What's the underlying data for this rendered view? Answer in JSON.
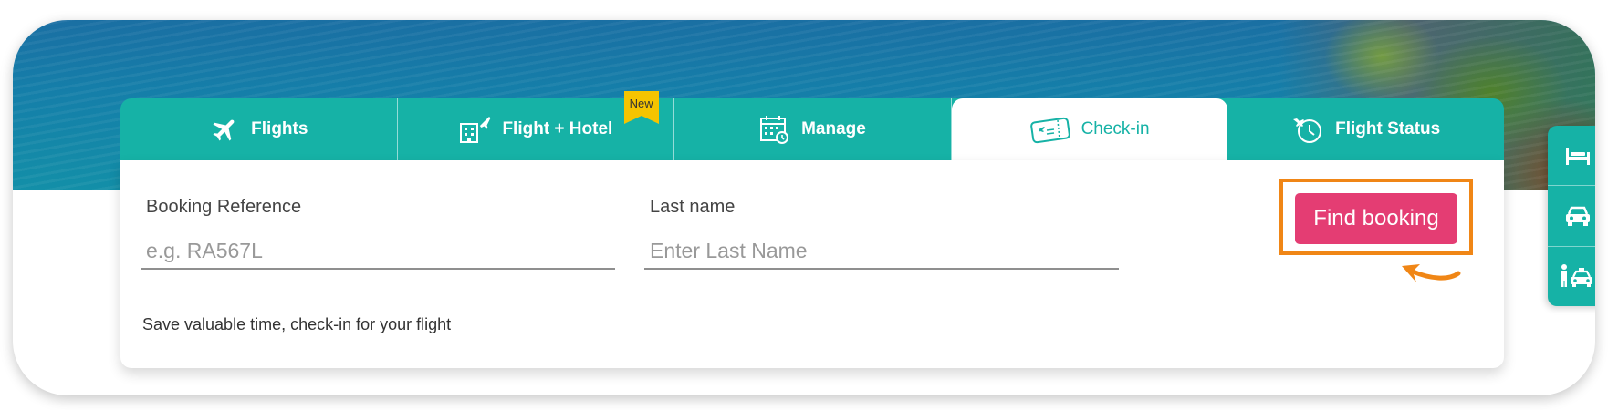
{
  "tabs": [
    {
      "label": "Flights",
      "icon": "plane-icon"
    },
    {
      "label": "Flight + Hotel",
      "icon": "hotel-plane-icon",
      "badge": "New"
    },
    {
      "label": "Manage",
      "icon": "calendar-icon"
    },
    {
      "label": "Check-in",
      "icon": "boarding-pass-icon",
      "active": true
    },
    {
      "label": "Flight Status",
      "icon": "plane-clock-icon"
    }
  ],
  "form": {
    "booking_reference": {
      "label": "Booking Reference",
      "placeholder": "e.g. RA567L",
      "value": ""
    },
    "last_name": {
      "label": "Last name",
      "placeholder": "Enter Last Name",
      "value": ""
    },
    "submit_label": "Find booking",
    "hint": "Save valuable time, check-in for your flight"
  },
  "side_menu": [
    {
      "icon": "bed-icon"
    },
    {
      "icon": "car-icon"
    },
    {
      "icon": "taxi-person-icon"
    }
  ],
  "colors": {
    "brand_teal": "#16b2a6",
    "cta_pink": "#e43d73",
    "highlight_orange": "#f08616",
    "badge_yellow": "#f5c400"
  }
}
